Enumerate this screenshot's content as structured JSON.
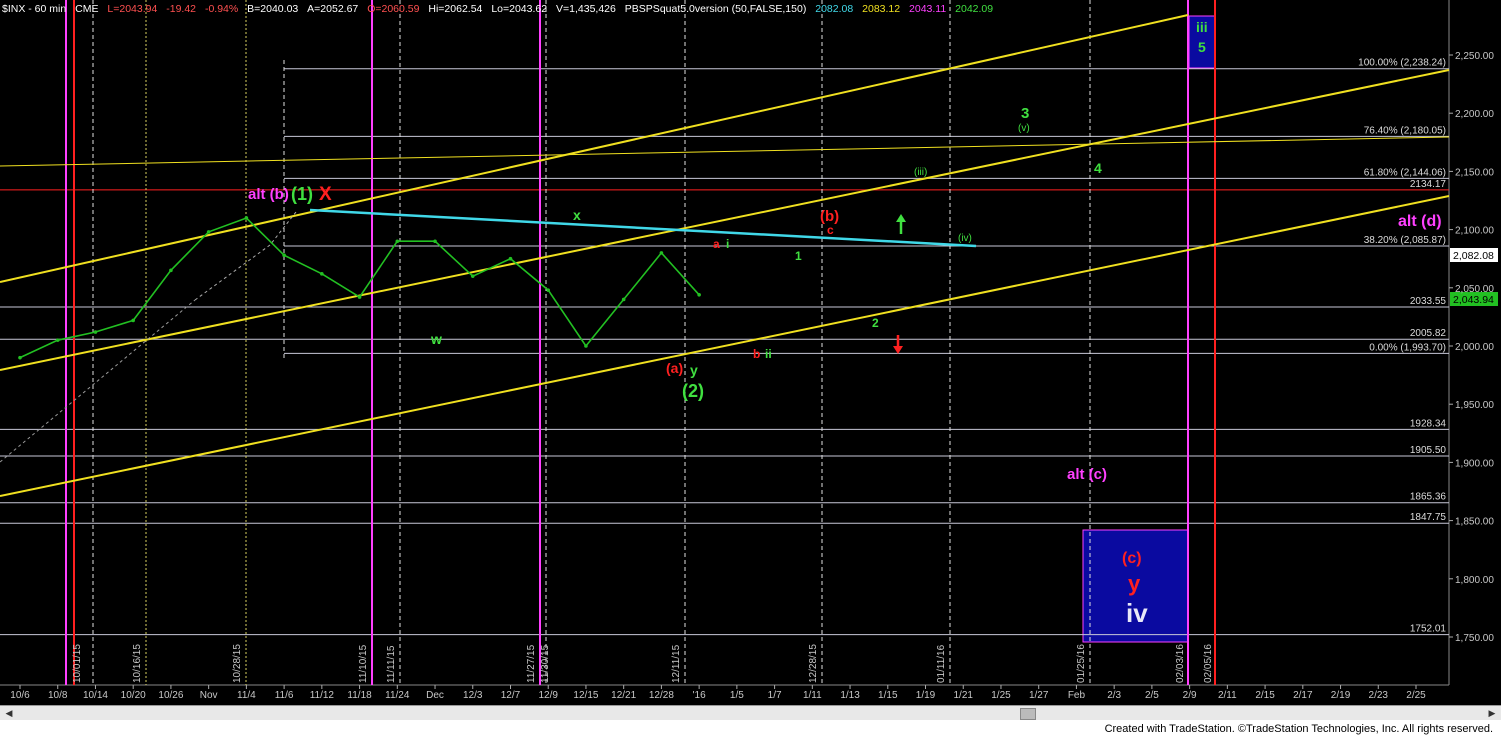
{
  "header": {
    "symbol": "$INX - 60 min",
    "exchange": "CME",
    "last": "L=2043.94",
    "change": "-19.42",
    "change_pct": "-0.94%",
    "bid": "B=2040.03",
    "ask": "A=2052.67",
    "open": "O=2060.59",
    "high": "Hi=2062.54",
    "low": "Lo=2043.62",
    "volume": "V=1,435,426",
    "indicator": "PBSPSquat5.0version (50,FALSE,150)",
    "ind_vals": [
      "2082.08",
      "2083.12",
      "2043.11",
      "2042.09"
    ]
  },
  "colors": {
    "background": "#000000",
    "price": "#22c022",
    "channel": "#f0e020",
    "trendline": "#40d8e8",
    "red": "#ff2020",
    "magenta": "#ff40ff",
    "green_label": "#40e040",
    "blue_box": "#0a0aa0"
  },
  "chart_data": {
    "type": "line",
    "title": "$INX - 60 min",
    "ylim": [
      1740,
      2290
    ],
    "y_ticks": [
      "2,250.00",
      "2,200.00",
      "2,150.00",
      "2,100.00",
      "2,050.00",
      "2,000.00",
      "1,950.00",
      "1,900.00",
      "1,850.00",
      "1,800.00",
      "1,750.00"
    ],
    "x_ticks": [
      "10/6",
      "10/8",
      "10/14",
      "10/20",
      "10/26",
      "Nov",
      "11/4",
      "11/6",
      "11/12",
      "11/18",
      "11/24",
      "Dec",
      "12/3",
      "12/7",
      "12/9",
      "12/15",
      "12/21",
      "12/28",
      "'16",
      "1/5",
      "1/7",
      "1/11",
      "1/13",
      "1/15",
      "1/19",
      "1/21",
      "1/25",
      "1/27",
      "Feb",
      "2/3",
      "2/5",
      "2/9",
      "2/11",
      "2/15",
      "2/17",
      "2/19",
      "2/23",
      "2/25"
    ],
    "series": [
      {
        "x": [
          "10/6",
          "10/8",
          "10/14",
          "10/20",
          "10/26",
          "Nov",
          "11/4",
          "11/6",
          "11/12",
          "11/18",
          "11/24",
          "Dec",
          "12/3",
          "12/7",
          "12/9",
          "12/15",
          "12/21",
          "12/28",
          "'16"
        ],
        "values": [
          1990,
          2005,
          2012,
          2022,
          2065,
          2098,
          2110,
          2078,
          2062,
          2042,
          2090,
          2090,
          2060,
          2075,
          2048,
          2000,
          2040,
          2080,
          2044
        ]
      }
    ],
    "price_labels": {
      "last": "2,043.94",
      "indicator": "2,082.08"
    },
    "fib_levels": [
      {
        "label": "100.00% (2,238.24)",
        "value": 2238.24
      },
      {
        "label": "76.40% (2,180.05)",
        "value": 2180.05
      },
      {
        "label": "61.80% (2,144.06)",
        "value": 2144.06
      },
      {
        "label": "2134.17",
        "value": 2134.17
      },
      {
        "label": "38.20% (2,085.87)",
        "value": 2085.87
      },
      {
        "label": "2033.55",
        "value": 2033.55
      },
      {
        "label": "2005.82",
        "value": 2005.82
      },
      {
        "label": "0.00% (1,993.70)",
        "value": 1993.7
      },
      {
        "label": "1928.34",
        "value": 1928.34
      },
      {
        "label": "1905.50",
        "value": 1905.5
      },
      {
        "label": "1865.36",
        "value": 1865.36
      },
      {
        "label": "1847.75",
        "value": 1847.75
      },
      {
        "label": "1752.01",
        "value": 1752.01
      }
    ],
    "vertical_date_labels": [
      "10/01/15",
      "10/16/15",
      "10/28/15",
      "11/10/15",
      "11/11/15",
      "11/27/15",
      "11/30/15",
      "12/11/15",
      "12/28/15",
      "01/11/16",
      "01/25/16",
      "02/03/16",
      "02/05/16"
    ],
    "annotations": {
      "alt_b": "alt (b)",
      "wave1": "(1)",
      "x_mark": "X",
      "w": "w",
      "x": "x",
      "a_red": "(a)",
      "y": "y",
      "wave2": "(2)",
      "a_small": "a",
      "i_small": "i",
      "b_small": "b",
      "ii_small": "ii",
      "b_red": "(b)",
      "c_small": "c",
      "one": "1",
      "two": "2",
      "three": "3",
      "v_small": "(v)",
      "iii_small": "(iii)",
      "iv_small": "(iv)",
      "four": "4",
      "iii_top": "iii",
      "five_top": "5",
      "alt_d": "alt (d)",
      "alt_c": "alt (c)",
      "c_box": "(c)",
      "y_box": "y",
      "iv_box": "iv"
    }
  },
  "footer": {
    "credit": "Created with TradeStation. ©TradeStation Technologies, Inc. All rights reserved."
  }
}
